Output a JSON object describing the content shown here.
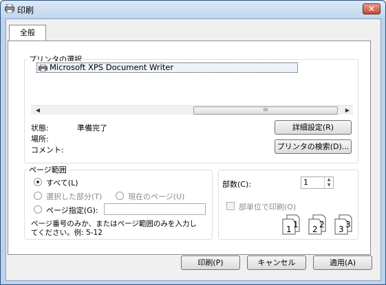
{
  "window": {
    "title": "印刷",
    "close": "✕"
  },
  "tab": "全般",
  "printer_group": {
    "legend": "プリンタの選択",
    "printers": [
      "Microsoft XPS Document Writer"
    ],
    "scroll_grip": "III",
    "status_label": "状態:",
    "status_value": "準備完了",
    "location_label": "場所:",
    "comment_label": "コメント:",
    "preferences_button": "詳細設定(R)",
    "find_printer_button": "プリンタの検索(D)..."
  },
  "range_group": {
    "legend": "ページ範囲",
    "all": "すべて(L)",
    "selection": "選択した部分(T)",
    "current_page": "現在のページ(U)",
    "pages": "ページ指定(G):",
    "pages_value": "",
    "hint_line1": "ページ番号のみか、またはページ範囲のみを入力し",
    "hint_line2": "てください。例: 5-12",
    "selected": "all"
  },
  "copies_group": {
    "copies_label": "部数(C):",
    "copies_value": "1",
    "collate_label": "部単位で印刷(O)",
    "collate_checked": false,
    "collate_numbers": [
      "1",
      "1",
      "2",
      "2",
      "3",
      "3"
    ]
  },
  "footer": {
    "print_button": "印刷(P)",
    "cancel_button": "キャンセル",
    "apply_button": "適用(A)"
  }
}
